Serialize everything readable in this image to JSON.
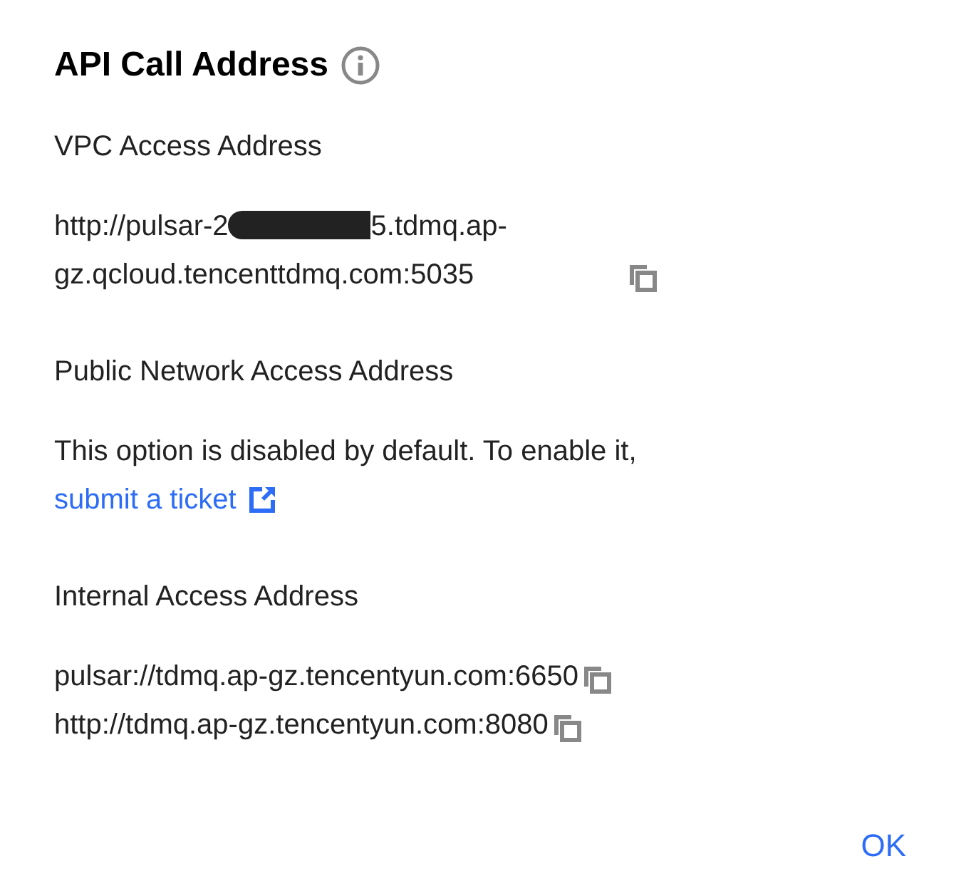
{
  "dialog": {
    "title": "API Call Address",
    "sections": [
      {
        "kind": "addresses",
        "label": "VPC Access Address",
        "addresses": [
          {
            "text": "http://pulsar-2",
            "redacted": true,
            "text_after_redaction": "5.tdmq.ap-gz.qcloud.tencenttdmq.com:5035"
          }
        ]
      },
      {
        "kind": "notice",
        "label": "Public Network Access Address",
        "text": "This option is disabled by default. To enable it,",
        "link": "submit a ticket"
      },
      {
        "kind": "addresses",
        "label": "Internal Access Address",
        "addresses": [
          {
            "text": "pulsar://tdmq.ap-gz.tencentyun.com:6650",
            "redacted": false
          },
          {
            "text": "http://tdmq.ap-gz.tencentyun.com:8080",
            "redacted": false
          }
        ]
      }
    ],
    "buttons": [
      "OK"
    ]
  }
}
